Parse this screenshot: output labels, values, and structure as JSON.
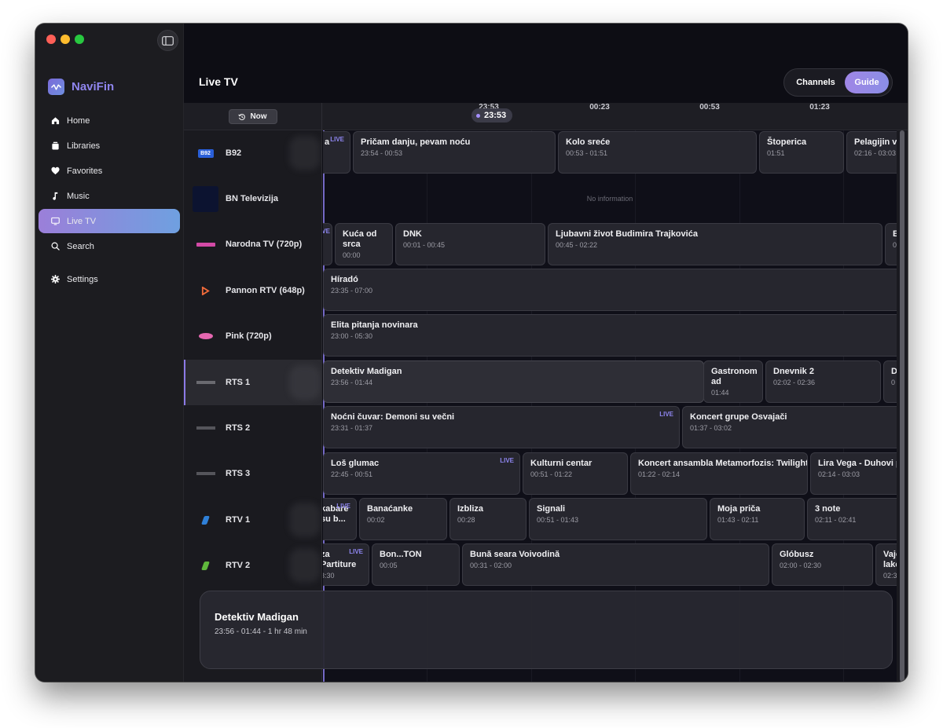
{
  "app": {
    "name": "NaviFin"
  },
  "sidebar": {
    "items": [
      {
        "label": "Home",
        "icon": "house-icon"
      },
      {
        "label": "Libraries",
        "icon": "shelf-icon"
      },
      {
        "label": "Favorites",
        "icon": "heart-icon"
      },
      {
        "label": "Music",
        "icon": "music-note-icon"
      },
      {
        "label": "Live TV",
        "icon": "tv-icon",
        "active": true
      },
      {
        "label": "Search",
        "icon": "search-icon"
      },
      {
        "label": "Settings",
        "icon": "gear-icon"
      }
    ]
  },
  "header": {
    "title": "Live TV",
    "view_toggle": {
      "channels": "Channels",
      "guide": "Guide",
      "selected": "Guide"
    }
  },
  "timebar": {
    "now_button": "Now",
    "now_time": "23:53",
    "ticks": [
      "23:53",
      "00:23",
      "00:53",
      "01:23"
    ]
  },
  "channels": [
    {
      "name": "B92",
      "logo": "B92"
    },
    {
      "name": "BN Televizija",
      "logo": ""
    },
    {
      "name": "Narodna TV (720p)",
      "logo": ""
    },
    {
      "name": "Pannon RTV (648p)",
      "logo": ""
    },
    {
      "name": "Pink (720p)",
      "logo": ""
    },
    {
      "name": "RTS 1",
      "logo": "",
      "active": true
    },
    {
      "name": "RTS 2",
      "logo": ""
    },
    {
      "name": "RTS 3",
      "logo": ""
    },
    {
      "name": "RTV 1",
      "logo": ""
    },
    {
      "name": "RTV 2",
      "logo": ""
    }
  ],
  "guide": {
    "no_info": "No information",
    "live_label": "LIVE",
    "rows": [
      [
        {
          "title": "a",
          "time": "",
          "live": true
        },
        {
          "title": "Pričam danju, pevam noću",
          "time": "23:54 - 00:53"
        },
        {
          "title": "Kolo sreće",
          "time": "00:53 - 01:51"
        },
        {
          "title": "Štoperica",
          "time": "01:51"
        },
        {
          "title": "Pelagijin ve",
          "time": "02:16 - 03:03"
        }
      ],
      [],
      [
        {
          "title": "VE",
          "time": "",
          "live": true
        },
        {
          "title": "Kuća od srca",
          "time": "00:00"
        },
        {
          "title": "DNK",
          "time": "00:01 - 00:45"
        },
        {
          "title": "Ljubavni život Budimira Trajkovića",
          "time": "00:45 - 02:22"
        },
        {
          "title": "E",
          "time": "0"
        }
      ],
      [
        {
          "title": "Híradó",
          "time": "23:35 - 07:00"
        }
      ],
      [
        {
          "title": "Elita pitanja novinara",
          "time": "23:00 - 05:30"
        }
      ],
      [
        {
          "title": "Detektiv Madigan",
          "time": "23:56 - 01:44"
        },
        {
          "title": "Gastronom ad",
          "time": "01:44"
        },
        {
          "title": "Dnevnik 2",
          "time": "02:02 - 02:36"
        },
        {
          "title": "D",
          "time": "0"
        }
      ],
      [
        {
          "title": "Noćni čuvar: Demoni su večni",
          "time": "23:31 - 01:37",
          "live": true
        },
        {
          "title": "Koncert grupe Osvajači",
          "time": "01:37 - 03:02"
        }
      ],
      [
        {
          "title": "Loš glumac",
          "time": "22:45 - 00:51",
          "live": true
        },
        {
          "title": "Kulturni centar",
          "time": "00:51 - 01:22"
        },
        {
          "title": "Koncert ansambla Metamorfozis: Twilight",
          "time": "01:22 - 02:14"
        },
        {
          "title": "Lira Vega - Duhovi pr",
          "time": "02:14 - 03:03"
        }
      ],
      [
        {
          "title": "kabare su b...",
          "time": "",
          "live": true
        },
        {
          "title": "Banaćanke",
          "time": "00:02"
        },
        {
          "title": "Izbliza",
          "time": "00:28"
        },
        {
          "title": "Signali",
          "time": "00:51 - 01:43"
        },
        {
          "title": "Moja priča",
          "time": "01:43 - 02:11"
        },
        {
          "title": "3 note",
          "time": "02:11 - 02:41"
        }
      ],
      [
        {
          "title": "za Partiture",
          "time": "3:30",
          "live": true
        },
        {
          "title": "Bon...TON",
          "time": "00:05"
        },
        {
          "title": "Bună seara Voivodină",
          "time": "00:31 - 02:00"
        },
        {
          "title": "Glóbusz",
          "time": "02:00 - 02:30"
        },
        {
          "title": "Vajo lako",
          "time": "02:3"
        }
      ]
    ]
  },
  "detail": {
    "title": "Detektiv Madigan",
    "subtitle": "23:56 - 01:44 - 1 hr 48 min"
  },
  "colors": {
    "accent": "#9b7fd9",
    "accent_blue": "#6fa0e0",
    "brand_text": "#8f85ee",
    "live": "#8e86f0"
  }
}
